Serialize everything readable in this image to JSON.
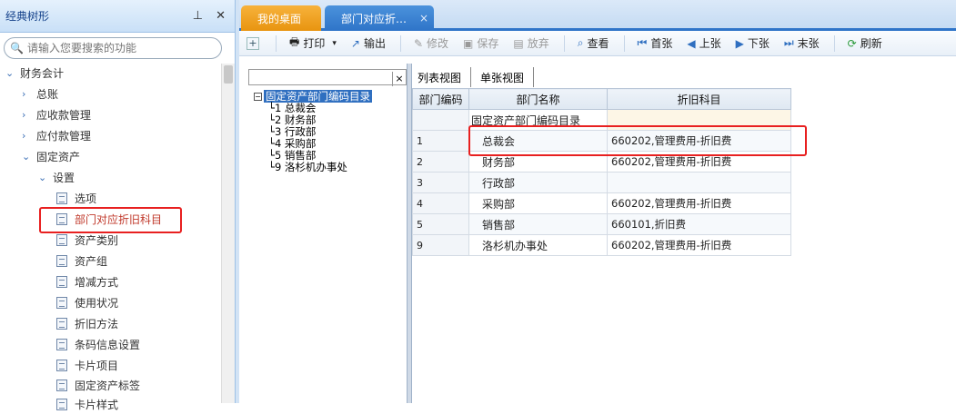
{
  "left_panel": {
    "title": "经典树形",
    "pin_icon": "pin-icon",
    "close_icon": "close-icon",
    "search_placeholder": "请输入您要搜索的功能",
    "tree": [
      {
        "label": "财务会计",
        "level": 0,
        "expanded": true
      },
      {
        "label": "总账",
        "level": 1,
        "expanded": false
      },
      {
        "label": "应收款管理",
        "level": 1,
        "expanded": false
      },
      {
        "label": "应付款管理",
        "level": 1,
        "expanded": false
      },
      {
        "label": "固定资产",
        "level": 1,
        "expanded": true
      },
      {
        "label": "设置",
        "level": 2,
        "expanded": true
      },
      {
        "label": "选项",
        "level": 3
      },
      {
        "label": "部门对应折旧科目",
        "level": 3,
        "selected": true
      },
      {
        "label": "资产类别",
        "level": 3
      },
      {
        "label": "资产组",
        "level": 3
      },
      {
        "label": "增减方式",
        "level": 3
      },
      {
        "label": "使用状况",
        "level": 3
      },
      {
        "label": "折旧方法",
        "level": 3
      },
      {
        "label": "条码信息设置",
        "level": 3
      },
      {
        "label": "卡片项目",
        "level": 3
      },
      {
        "label": "固定资产标签",
        "level": 3
      },
      {
        "label": "卡片样式",
        "level": 3
      }
    ]
  },
  "tabs": [
    {
      "label": "我的桌面",
      "active": false
    },
    {
      "label": "部门对应折…",
      "active": true,
      "close": "×"
    }
  ],
  "toolbar": {
    "add": "+",
    "print": "打印",
    "export": "输出",
    "edit": "修改",
    "save": "保存",
    "discard": "放弃",
    "view": "查看",
    "first": "首张",
    "prev": "上张",
    "next": "下张",
    "last": "末张",
    "refresh": "刷新"
  },
  "mid_tree": {
    "close": "×",
    "root": "固定资产部门编码目录",
    "children": [
      "1 总裁会",
      "2 财务部",
      "3 行政部",
      "4 采购部",
      "5 销售部",
      "9 洛杉机办事处"
    ]
  },
  "view_tabs": [
    "列表视图",
    "单张视图"
  ],
  "grid": {
    "headers": [
      "部门编码",
      "部门名称",
      "折旧科目"
    ],
    "rows": [
      {
        "code": "",
        "name": "固定资产部门编码目录",
        "acct": ""
      },
      {
        "code": "1",
        "name": "总裁会",
        "acct": "660202,管理费用-折旧费"
      },
      {
        "code": "2",
        "name": "财务部",
        "acct": "660202,管理费用-折旧费"
      },
      {
        "code": "3",
        "name": "行政部",
        "acct": ""
      },
      {
        "code": "4",
        "name": "采购部",
        "acct": "660202,管理费用-折旧费"
      },
      {
        "code": "5",
        "name": "销售部",
        "acct": "660101,折旧费"
      },
      {
        "code": "9",
        "name": "洛杉机办事处",
        "acct": "660202,管理费用-折旧费"
      }
    ]
  },
  "colors": {
    "accent": "#2f74c8",
    "tab_home": "#f0a025",
    "highlight": "#e82020"
  }
}
